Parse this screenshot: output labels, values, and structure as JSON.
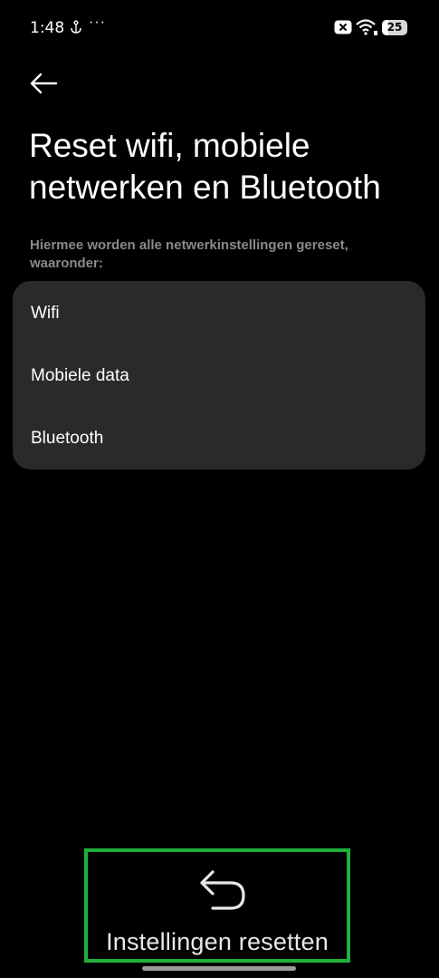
{
  "status_bar": {
    "time": "1:48",
    "notification_icons": [
      "anchor-icon",
      "more-dots-icon"
    ],
    "dots": "···",
    "battery_level": "25",
    "battery_fraction": 0.25,
    "right_icons": [
      "close-box-icon",
      "wifi-icon",
      "battery-icon"
    ]
  },
  "header": {
    "back_icon": "arrow-left-icon",
    "title": "Reset wifi, mobiele netwerken en Bluetooth"
  },
  "description": "Hiermee worden alle netwerkinstellingen gereset, waaronder:",
  "items": [
    {
      "label": "Wifi"
    },
    {
      "label": "Mobiele data"
    },
    {
      "label": "Bluetooth"
    }
  ],
  "bottom_action": {
    "icon": "undo-icon",
    "label": "Instellingen resetten",
    "highlight_color": "#20b038"
  },
  "colors": {
    "background": "#000000",
    "card": "#2a2a2a",
    "text_primary": "#ffffff",
    "text_secondary": "#8a8a8a"
  }
}
